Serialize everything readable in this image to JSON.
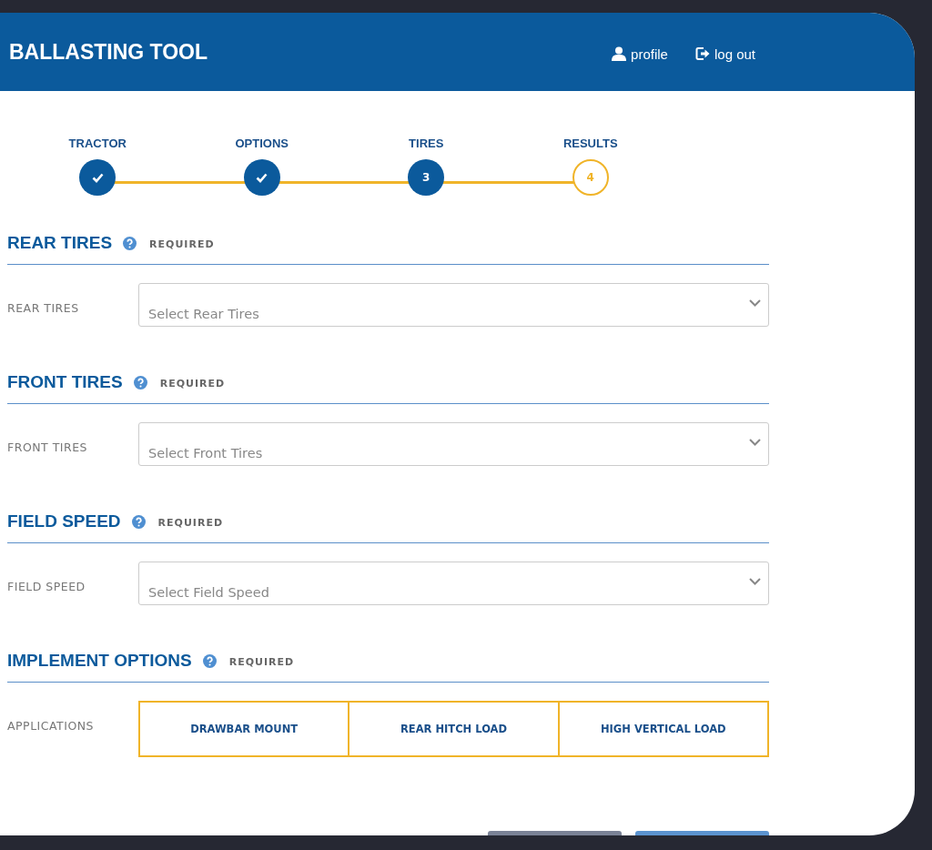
{
  "header": {
    "title": "BALLASTING TOOL",
    "links": [
      {
        "kind": "profile",
        "label": "profile"
      },
      {
        "kind": "logout",
        "label": "log out"
      }
    ]
  },
  "steps": [
    {
      "label": "TRACTOR",
      "completed": true,
      "current": false
    },
    {
      "label": "OPTIONS",
      "completed": true,
      "current": false
    },
    {
      "label": "TIRES",
      "completed": false,
      "current": true,
      "number": "3"
    },
    {
      "label": "RESULTS",
      "completed": false,
      "current": false,
      "number": "4"
    }
  ],
  "sections": [
    {
      "title": "REAR TIRES",
      "badge": "REQUIRED",
      "kind": "select",
      "field_label": "REAR TIRES",
      "placeholder": "Select Rear Tires"
    },
    {
      "title": "FRONT TIRES",
      "badge": "REQUIRED",
      "kind": "select",
      "field_label": "FRONT TIRES",
      "placeholder": "Select Front Tires"
    },
    {
      "title": "FIELD SPEED",
      "badge": "REQUIRED",
      "kind": "select",
      "field_label": "FIELD SPEED",
      "placeholder": "Select Field Speed"
    },
    {
      "title": "IMPLEMENT OPTIONS",
      "badge": "REQUIRED",
      "kind": "options",
      "field_label": "APPLICATIONS",
      "options": [
        {
          "label": "DRAWBAR MOUNT",
          "selected": false
        },
        {
          "label": "REAR HITCH LOAD",
          "selected": false
        },
        {
          "label": "HIGH VERTICAL LOAD",
          "selected": false
        }
      ]
    }
  ],
  "footer_buttons": [
    {
      "kind": "secondary"
    },
    {
      "kind": "primary"
    }
  ]
}
